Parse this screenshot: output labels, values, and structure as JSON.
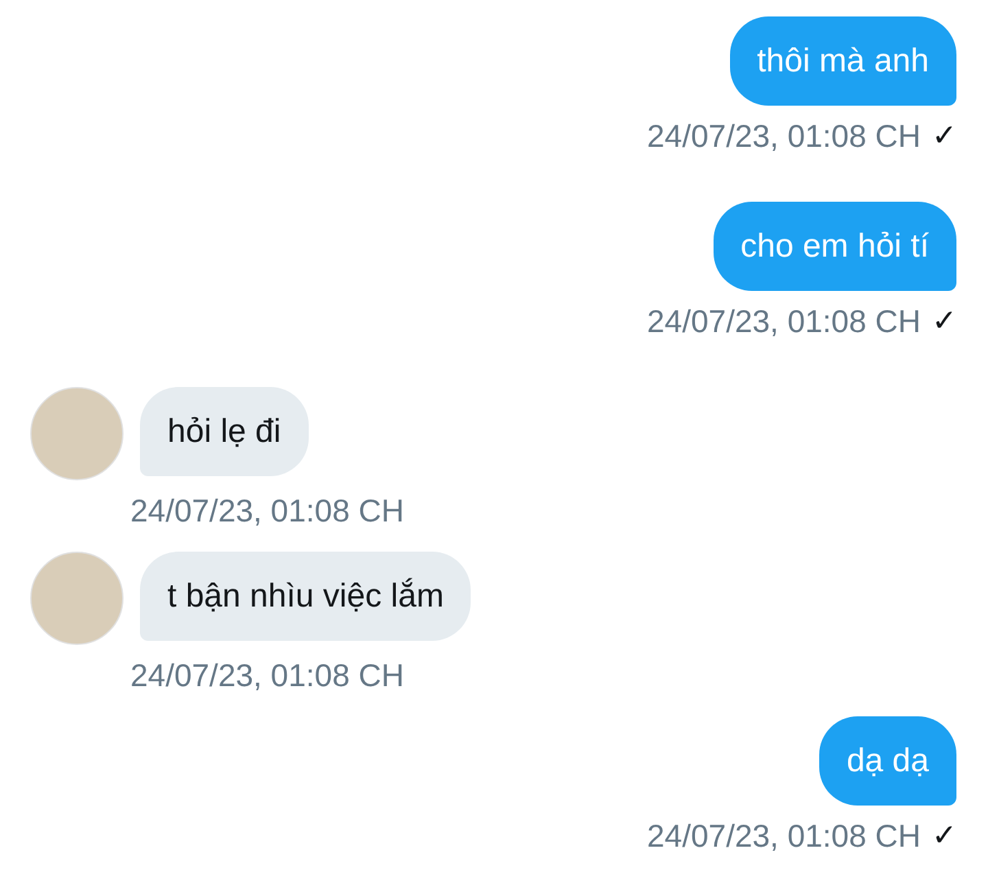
{
  "messages": [
    {
      "kind": "sent",
      "text": "thôi mà anh",
      "time": "24/07/23, 01:08 CH",
      "status": "✓"
    },
    {
      "kind": "sent",
      "text": "cho em hỏi tí",
      "time": "24/07/23, 01:08 CH",
      "status": "✓"
    },
    {
      "kind": "received",
      "text": "hỏi lẹ đi",
      "time": "24/07/23, 01:08 CH"
    },
    {
      "kind": "received",
      "text": "t bận nhìu việc lắm",
      "time": "24/07/23, 01:08 CH"
    },
    {
      "kind": "sent",
      "text": "dạ dạ",
      "time": "24/07/23, 01:08 CH",
      "status": "✓"
    }
  ]
}
